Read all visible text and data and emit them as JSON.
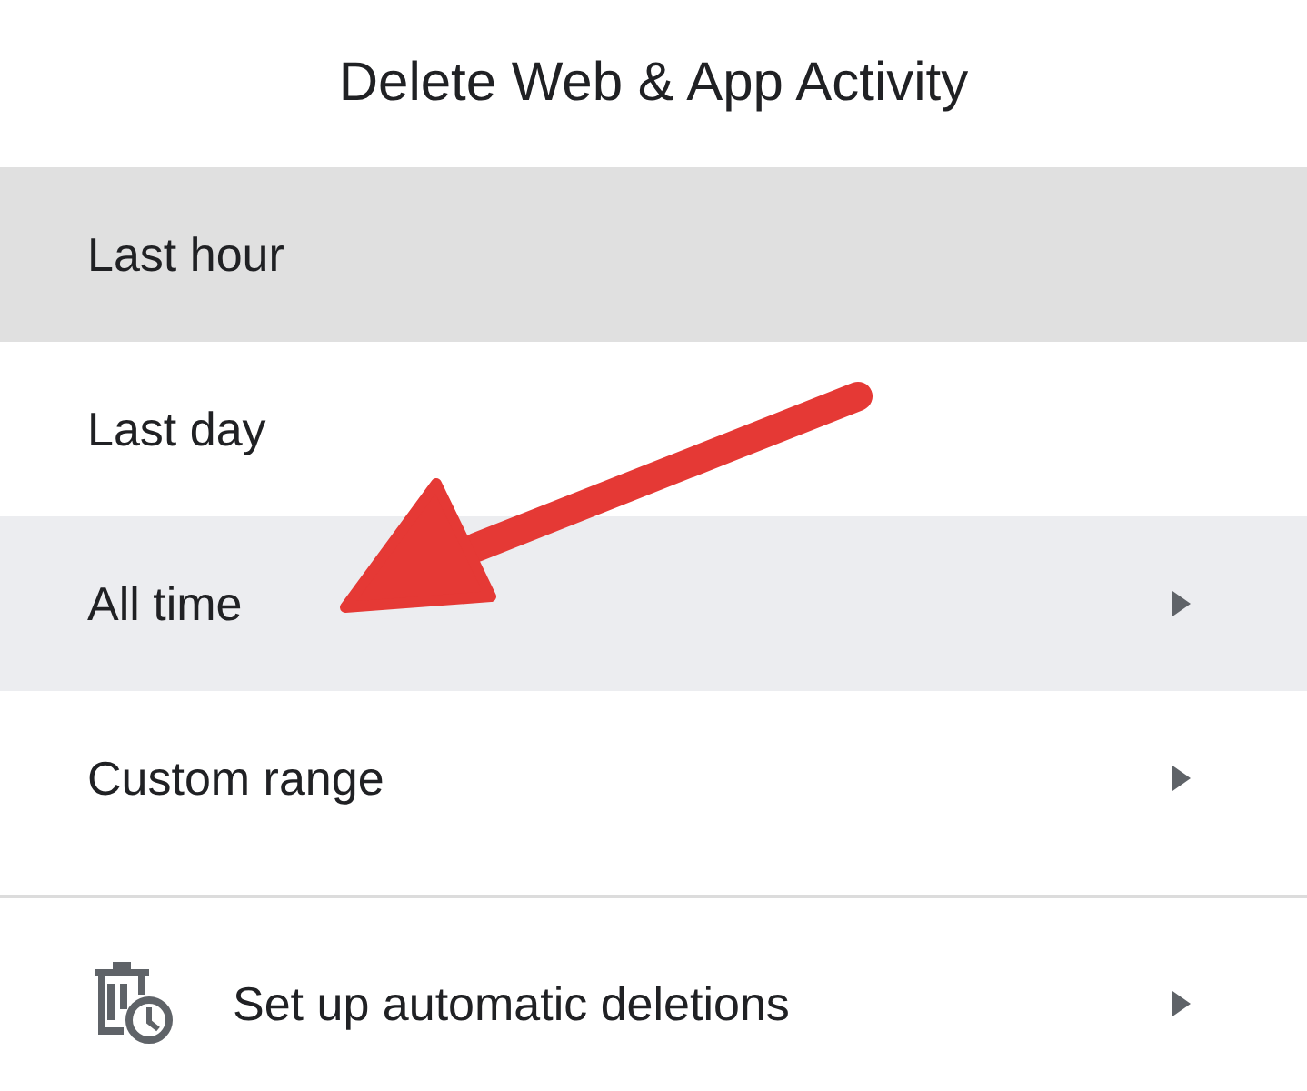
{
  "title": "Delete Web & App Activity",
  "options": [
    {
      "label": "Last hour",
      "selected": true,
      "focused": false,
      "submenu": false
    },
    {
      "label": "Last day",
      "selected": false,
      "focused": false,
      "submenu": false
    },
    {
      "label": "All time",
      "selected": false,
      "focused": true,
      "submenu": true
    },
    {
      "label": "Custom range",
      "selected": false,
      "focused": false,
      "submenu": true
    }
  ],
  "footer_item": {
    "label": "Set up automatic deletions",
    "submenu": true
  }
}
